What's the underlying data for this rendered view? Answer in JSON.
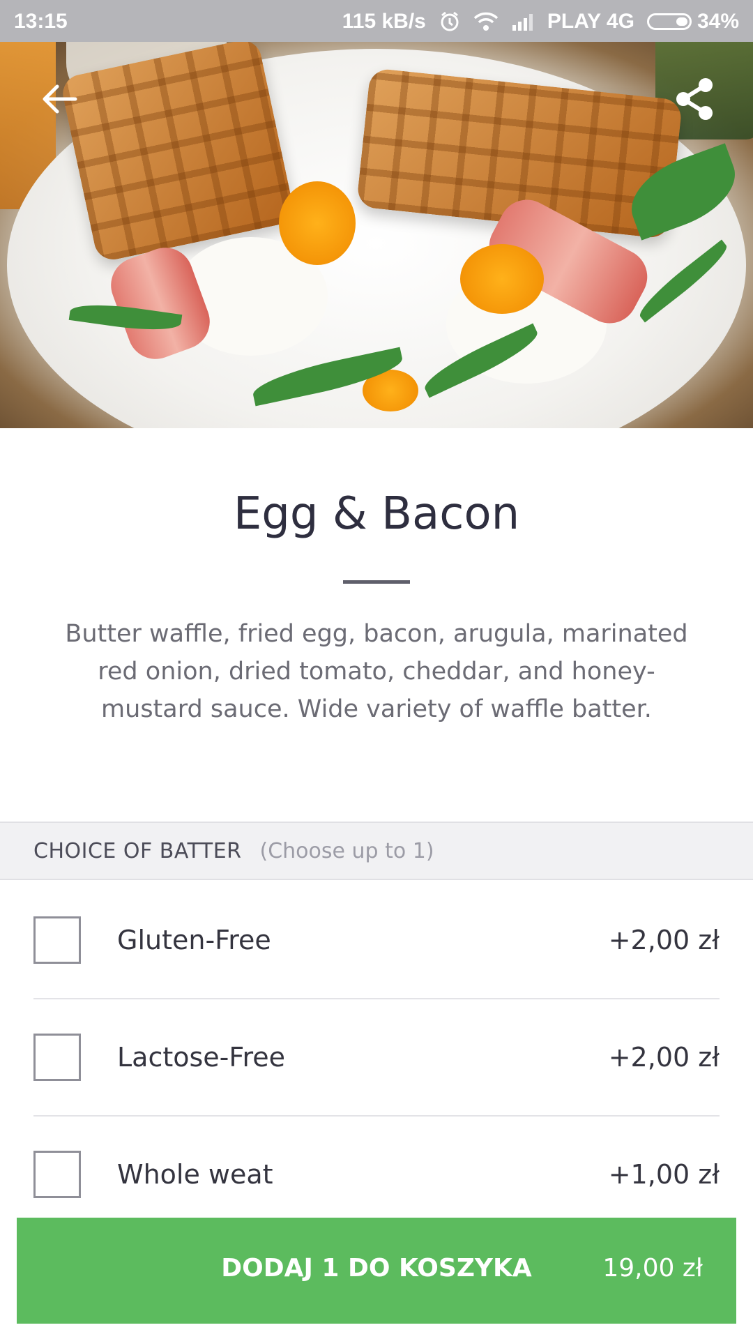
{
  "status_bar": {
    "time": "13:15",
    "net_speed": "115 kB/s",
    "carrier": "PLAY 4G",
    "battery": "34%"
  },
  "header": {
    "back_icon": "arrow-left-icon",
    "share_icon": "share-icon"
  },
  "item": {
    "title": "Egg & Bacon",
    "description": "Butter waffle, fried egg, bacon, arugula, marinated red onion, dried tomato, cheddar, and honey-mustard sauce. Wide variety of waffle batter."
  },
  "options_section": {
    "label": "CHOICE OF BATTER",
    "hint": "(Choose up to 1)",
    "options": [
      {
        "name": "Gluten-Free",
        "price": "+2,00 zł",
        "checked": false
      },
      {
        "name": "Lactose-Free",
        "price": "+2,00 zł",
        "checked": false
      },
      {
        "name": "Whole weat",
        "price": "+1,00 zł",
        "checked": false
      }
    ]
  },
  "cart_button": {
    "label": "DODAJ 1 DO KOSZYKA",
    "price": "19,00 zł",
    "color": "#5cbb5e"
  }
}
